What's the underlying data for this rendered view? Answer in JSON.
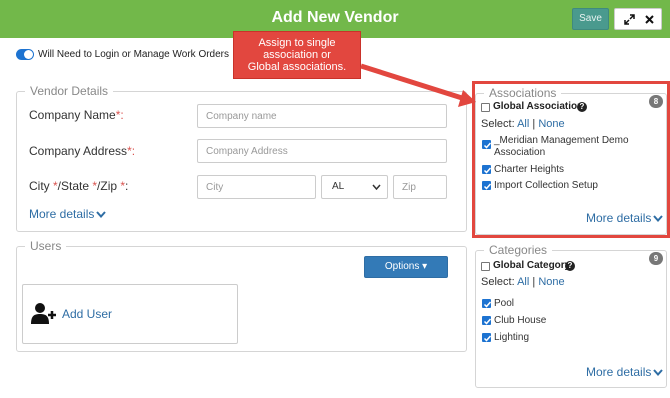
{
  "header": {
    "title": "Add New Vendor",
    "save_label": "Save",
    "expand_icon": "expand-icon",
    "close_icon": "close-icon",
    "accent": "#72b84a"
  },
  "login_toggle": {
    "label": "Will Need to Login or Manage Work Orders",
    "on": true
  },
  "callout": {
    "lines": [
      "Assign to single",
      "association or",
      "Global associations."
    ],
    "color": "#e2473f"
  },
  "vendor_details": {
    "legend": "Vendor Details",
    "company_name": {
      "label": "Company Name",
      "required": "*:",
      "placeholder": "Company name"
    },
    "company_address": {
      "label": "Company Address",
      "required": "*:",
      "placeholder": "Company Address"
    },
    "city_state_zip": {
      "label_city": "City ",
      "label_state": "/State ",
      "label_zip": "/Zip ",
      "colon": ":",
      "star": "*",
      "city_placeholder": "City",
      "state_value": "AL",
      "zip_placeholder": "Zip"
    },
    "more_details": "More details"
  },
  "users": {
    "legend": "Users",
    "options_label": "Options",
    "add_user_label": "Add User"
  },
  "associations": {
    "legend": "Associations",
    "count": "8",
    "global_label": "Global Association",
    "select_label": "Select:",
    "all": "All",
    "separator": "|",
    "none": "None",
    "items": [
      {
        "line1": "_Meridian Management Demo",
        "line2": "Association",
        "checked": true
      },
      {
        "line1": "Charter Heights",
        "checked": true
      },
      {
        "line1": "Import Collection Setup",
        "checked": true
      }
    ],
    "more_details": "More details"
  },
  "categories": {
    "legend": "Categories",
    "count": "9",
    "global_label": "Global Category",
    "select_label": "Select:",
    "all": "All",
    "separator": "|",
    "none": "None",
    "items": [
      {
        "label": "Pool",
        "checked": true
      },
      {
        "label": "Club House",
        "checked": true
      },
      {
        "label": "Lighting",
        "checked": true
      }
    ],
    "more_details": "More details"
  }
}
